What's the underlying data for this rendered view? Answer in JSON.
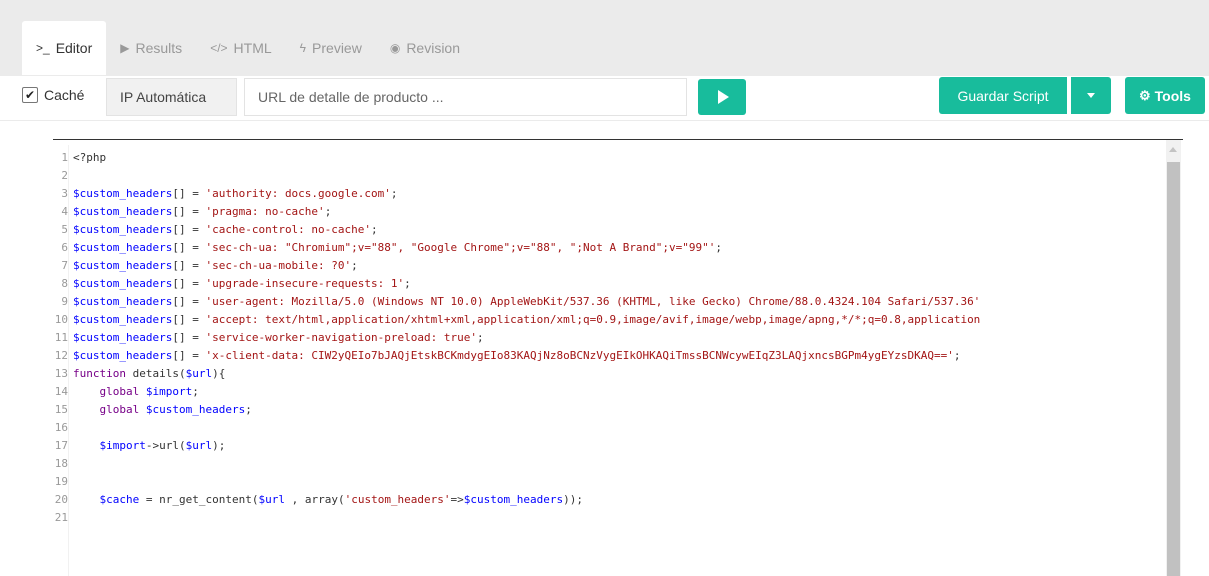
{
  "tabs": [
    {
      "label": "Editor",
      "icon": "terminal-icon",
      "glyph": ">_",
      "active": true
    },
    {
      "label": "Results",
      "icon": "play-icon",
      "glyph": "▶",
      "active": false
    },
    {
      "label": "HTML",
      "icon": "code-icon",
      "glyph": "</>",
      "active": false
    },
    {
      "label": "Preview",
      "icon": "bolt-icon",
      "glyph": "ϟ",
      "active": false
    },
    {
      "label": "Revision",
      "icon": "eye-icon",
      "glyph": "◉",
      "active": false
    }
  ],
  "toolbar": {
    "cache_label": "Caché",
    "cache_checked": true,
    "ip_label": "IP Automática",
    "url_placeholder": "URL de detalle de producto ...",
    "url_value": "",
    "save_label": "Guardar Script",
    "tools_label": "Tools"
  },
  "colors": {
    "accent": "#18bc9c",
    "variable": "#0000ff",
    "string": "#a31515",
    "keyword": "#770088"
  },
  "editor": {
    "lines": [
      [
        [
          "t",
          "<?php"
        ]
      ],
      [],
      [
        [
          "v",
          "$custom_headers"
        ],
        [
          "t",
          "[] = "
        ],
        [
          "s",
          "'authority: docs.google.com'"
        ],
        [
          "t",
          ";"
        ]
      ],
      [
        [
          "v",
          "$custom_headers"
        ],
        [
          "t",
          "[] = "
        ],
        [
          "s",
          "'pragma: no-cache'"
        ],
        [
          "t",
          ";"
        ]
      ],
      [
        [
          "v",
          "$custom_headers"
        ],
        [
          "t",
          "[] = "
        ],
        [
          "s",
          "'cache-control: no-cache'"
        ],
        [
          "t",
          ";"
        ]
      ],
      [
        [
          "v",
          "$custom_headers"
        ],
        [
          "t",
          "[] = "
        ],
        [
          "s",
          "'sec-ch-ua: \"Chromium\";v=\"88\", \"Google Chrome\";v=\"88\", \";Not A Brand\";v=\"99\"'"
        ],
        [
          "t",
          ";"
        ]
      ],
      [
        [
          "v",
          "$custom_headers"
        ],
        [
          "t",
          "[] = "
        ],
        [
          "s",
          "'sec-ch-ua-mobile: ?0'"
        ],
        [
          "t",
          ";"
        ]
      ],
      [
        [
          "v",
          "$custom_headers"
        ],
        [
          "t",
          "[] = "
        ],
        [
          "s",
          "'upgrade-insecure-requests: 1'"
        ],
        [
          "t",
          ";"
        ]
      ],
      [
        [
          "v",
          "$custom_headers"
        ],
        [
          "t",
          "[] = "
        ],
        [
          "s",
          "'user-agent: Mozilla/5.0 (Windows NT 10.0) AppleWebKit/537.36 (KHTML, like Gecko) Chrome/88.0.4324.104 Safari/537.36'"
        ]
      ],
      [
        [
          "v",
          "$custom_headers"
        ],
        [
          "t",
          "[] = "
        ],
        [
          "s",
          "'accept: text/html,application/xhtml+xml,application/xml;q=0.9,image/avif,image/webp,image/apng,*/*;q=0.8,application"
        ]
      ],
      [
        [
          "v",
          "$custom_headers"
        ],
        [
          "t",
          "[] = "
        ],
        [
          "s",
          "'service-worker-navigation-preload: true'"
        ],
        [
          "t",
          ";"
        ]
      ],
      [
        [
          "v",
          "$custom_headers"
        ],
        [
          "t",
          "[] = "
        ],
        [
          "s",
          "'x-client-data: CIW2yQEIo7bJAQjEtskBCKmdygEIo83KAQjNz8oBCNzVygEIkOHKAQiTmssBCNWcywEIqZ3LAQjxncsBGPm4ygEYzsDKAQ=='"
        ],
        [
          "t",
          ";"
        ]
      ],
      [
        [
          "k",
          "function"
        ],
        [
          "t",
          " details("
        ],
        [
          "v",
          "$url"
        ],
        [
          "t",
          "){"
        ]
      ],
      [
        [
          "t",
          "    "
        ],
        [
          "k",
          "global"
        ],
        [
          "t",
          " "
        ],
        [
          "v",
          "$import"
        ],
        [
          "t",
          ";"
        ]
      ],
      [
        [
          "t",
          "    "
        ],
        [
          "k",
          "global"
        ],
        [
          "t",
          " "
        ],
        [
          "v",
          "$custom_headers"
        ],
        [
          "t",
          ";"
        ]
      ],
      [],
      [
        [
          "t",
          "    "
        ],
        [
          "v",
          "$import"
        ],
        [
          "t",
          "->url("
        ],
        [
          "v",
          "$url"
        ],
        [
          "t",
          ");"
        ]
      ],
      [],
      [],
      [
        [
          "t",
          "    "
        ],
        [
          "v",
          "$cache"
        ],
        [
          "t",
          " = nr_get_content("
        ],
        [
          "v",
          "$url"
        ],
        [
          "t",
          " , array("
        ],
        [
          "s",
          "'custom_headers'"
        ],
        [
          "t",
          "=>"
        ],
        [
          "v",
          "$custom_headers"
        ],
        [
          "t",
          "));"
        ]
      ],
      []
    ]
  }
}
